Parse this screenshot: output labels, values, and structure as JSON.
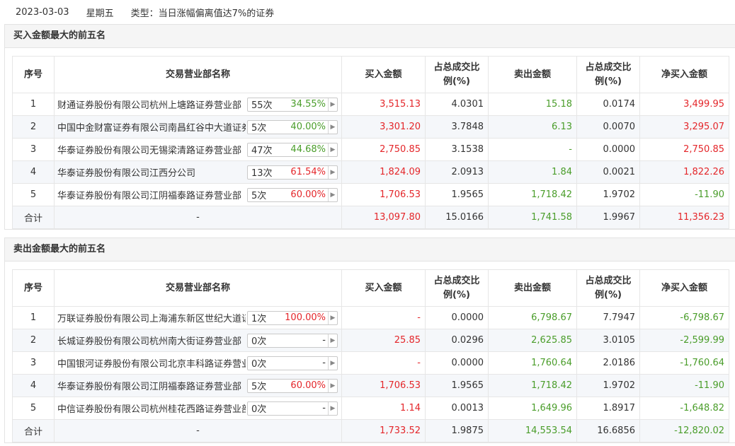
{
  "header": {
    "date": "2023-03-03",
    "weekday": "星期五",
    "type_label": "类型：当日涨幅偏离值达7%的证券"
  },
  "colors": {
    "up": "#e4262a",
    "down": "#4a9d2a"
  },
  "columns": [
    "序号",
    "交易营业部名称",
    "买入金额",
    "占总成交比例(%)",
    "卖出金额",
    "占总成交比例(%)",
    "净买入金额"
  ],
  "buy_section": {
    "title": "买入金额最大的前五名",
    "rows": [
      {
        "idx": "1",
        "name": "财通证券股份有限公司杭州上塘路证券营业部",
        "count": "55次",
        "pct": "34.55%",
        "pct_color": "green",
        "buy": "3,515.13",
        "buy_ratio": "4.0301",
        "sell": "15.18",
        "sell_ratio": "0.0174",
        "net": "3,499.95",
        "net_color": "red"
      },
      {
        "idx": "2",
        "name": "中国中金财富证券有限公司南昌红谷中大道证券营业部",
        "count": "5次",
        "pct": "40.00%",
        "pct_color": "green",
        "buy": "3,301.20",
        "buy_ratio": "3.7848",
        "sell": "6.13",
        "sell_ratio": "0.0070",
        "net": "3,295.07",
        "net_color": "red"
      },
      {
        "idx": "3",
        "name": "华泰证券股份有限公司无锡梁清路证券营业部",
        "count": "47次",
        "pct": "44.68%",
        "pct_color": "green",
        "buy": "2,750.85",
        "buy_ratio": "3.1538",
        "sell": "-",
        "sell_ratio": "0.0000",
        "net": "2,750.85",
        "net_color": "red"
      },
      {
        "idx": "4",
        "name": "华泰证券股份有限公司江西分公司",
        "count": "13次",
        "pct": "61.54%",
        "pct_color": "red",
        "buy": "1,824.09",
        "buy_ratio": "2.0913",
        "sell": "1.84",
        "sell_ratio": "0.0021",
        "net": "1,822.26",
        "net_color": "red"
      },
      {
        "idx": "5",
        "name": "华泰证券股份有限公司江阴福泰路证券营业部",
        "count": "5次",
        "pct": "60.00%",
        "pct_color": "red",
        "buy": "1,706.53",
        "buy_ratio": "1.9565",
        "sell": "1,718.42",
        "sell_ratio": "1.9702",
        "net": "-11.90",
        "net_color": "green"
      }
    ],
    "total": {
      "label": "合计",
      "name": "-",
      "buy": "13,097.80",
      "buy_ratio": "15.0166",
      "sell": "1,741.58",
      "sell_ratio": "1.9967",
      "net": "11,356.23",
      "net_color": "red"
    }
  },
  "sell_section": {
    "title": "卖出金额最大的前五名",
    "rows": [
      {
        "idx": "1",
        "name": "万联证券股份有限公司上海浦东新区世纪大道证券营业部",
        "count": "1次",
        "pct": "100.00%",
        "pct_color": "red",
        "buy": "-",
        "buy_ratio": "0.0000",
        "sell": "6,798.67",
        "sell_ratio": "7.7947",
        "net": "-6,798.67",
        "net_color": "green"
      },
      {
        "idx": "2",
        "name": "长城证券股份有限公司杭州南大街证券营业部",
        "count": "0次",
        "pct": "-",
        "pct_color": "dark",
        "buy": "25.85",
        "buy_ratio": "0.0296",
        "sell": "2,625.85",
        "sell_ratio": "3.0105",
        "net": "-2,599.99",
        "net_color": "green"
      },
      {
        "idx": "3",
        "name": "中国银河证券股份有限公司北京丰科路证券营业部",
        "count": "0次",
        "pct": "-",
        "pct_color": "dark",
        "buy": "-",
        "buy_ratio": "0.0000",
        "sell": "1,760.64",
        "sell_ratio": "2.0186",
        "net": "-1,760.64",
        "net_color": "green"
      },
      {
        "idx": "4",
        "name": "华泰证券股份有限公司江阴福泰路证券营业部",
        "count": "5次",
        "pct": "60.00%",
        "pct_color": "red",
        "buy": "1,706.53",
        "buy_ratio": "1.9565",
        "sell": "1,718.42",
        "sell_ratio": "1.9702",
        "net": "-11.90",
        "net_color": "green"
      },
      {
        "idx": "5",
        "name": "中信证券股份有限公司杭州桂花西路证券营业部",
        "count": "0次",
        "pct": "-",
        "pct_color": "dark",
        "buy": "1.14",
        "buy_ratio": "0.0013",
        "sell": "1,649.96",
        "sell_ratio": "1.8917",
        "net": "-1,648.82",
        "net_color": "green"
      }
    ],
    "total": {
      "label": "合计",
      "name": "-",
      "buy": "1,733.52",
      "buy_ratio": "1.9875",
      "sell": "14,553.54",
      "sell_ratio": "16.6856",
      "net": "-12,820.02",
      "net_color": "green"
    }
  }
}
